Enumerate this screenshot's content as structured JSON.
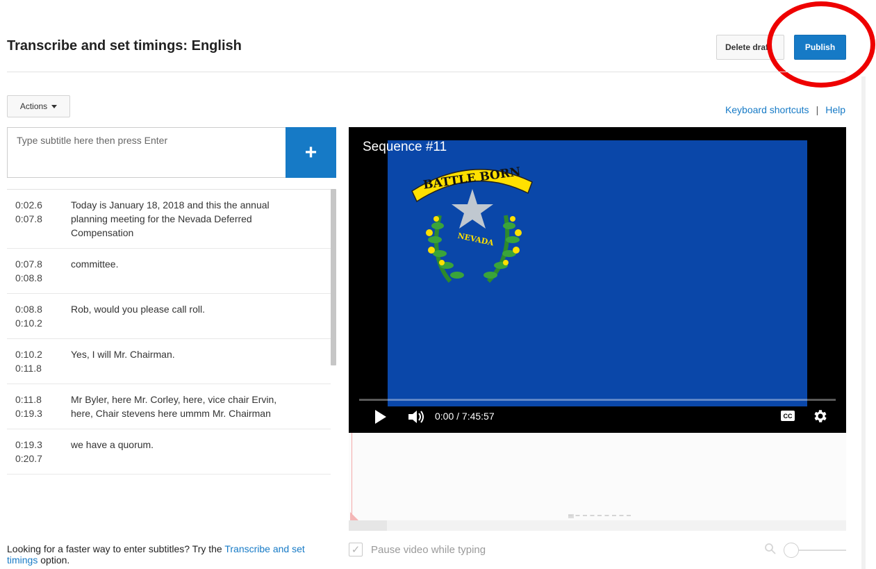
{
  "header": {
    "title": "Transcribe and set timings: English",
    "delete_label": "Delete draft",
    "publish_label": "Publish"
  },
  "toolbar": {
    "actions_label": "Actions",
    "keyboard_shortcuts": "Keyboard shortcuts",
    "separator": "|",
    "help": "Help"
  },
  "editor": {
    "placeholder": "Type subtitle here then press Enter",
    "add_label": "+"
  },
  "captions": [
    {
      "start": "0:02.6",
      "end": "0:07.8",
      "text": "Today is January 18, 2018 and this the annual\nplanning meeting for the Nevada Deferred Compensation"
    },
    {
      "start": "0:07.8",
      "end": "0:08.8",
      "text": "committee."
    },
    {
      "start": "0:08.8",
      "end": "0:10.2",
      "text": "Rob, would you please call roll."
    },
    {
      "start": "0:10.2",
      "end": "0:11.8",
      "text": "Yes, I will Mr. Chairman."
    },
    {
      "start": "0:11.8",
      "end": "0:19.3",
      "text": "Mr Byler, here Mr. Corley, here, vice chair Ervin, here, Chair stevens here ummm Mr. Chairman"
    },
    {
      "start": "0:19.3",
      "end": "0:20.7",
      "text": "we have a quorum."
    }
  ],
  "video": {
    "title": "Sequence #11",
    "time": "0:00 / 7:45:57",
    "seal_top_text": "BATTLE BORN",
    "seal_bottom_text": "NEVADA",
    "cc_label": "CC"
  },
  "footer": {
    "pause_label": "Pause video while typing",
    "faster_prefix": "Looking for a faster way to enter subtitles? Try the ",
    "faster_link": "Transcribe and set timings",
    "faster_suffix": " option."
  },
  "colors": {
    "accent": "#167ac6",
    "flag_blue": "#0a47a9",
    "highlight_ring": "#ee0000"
  }
}
